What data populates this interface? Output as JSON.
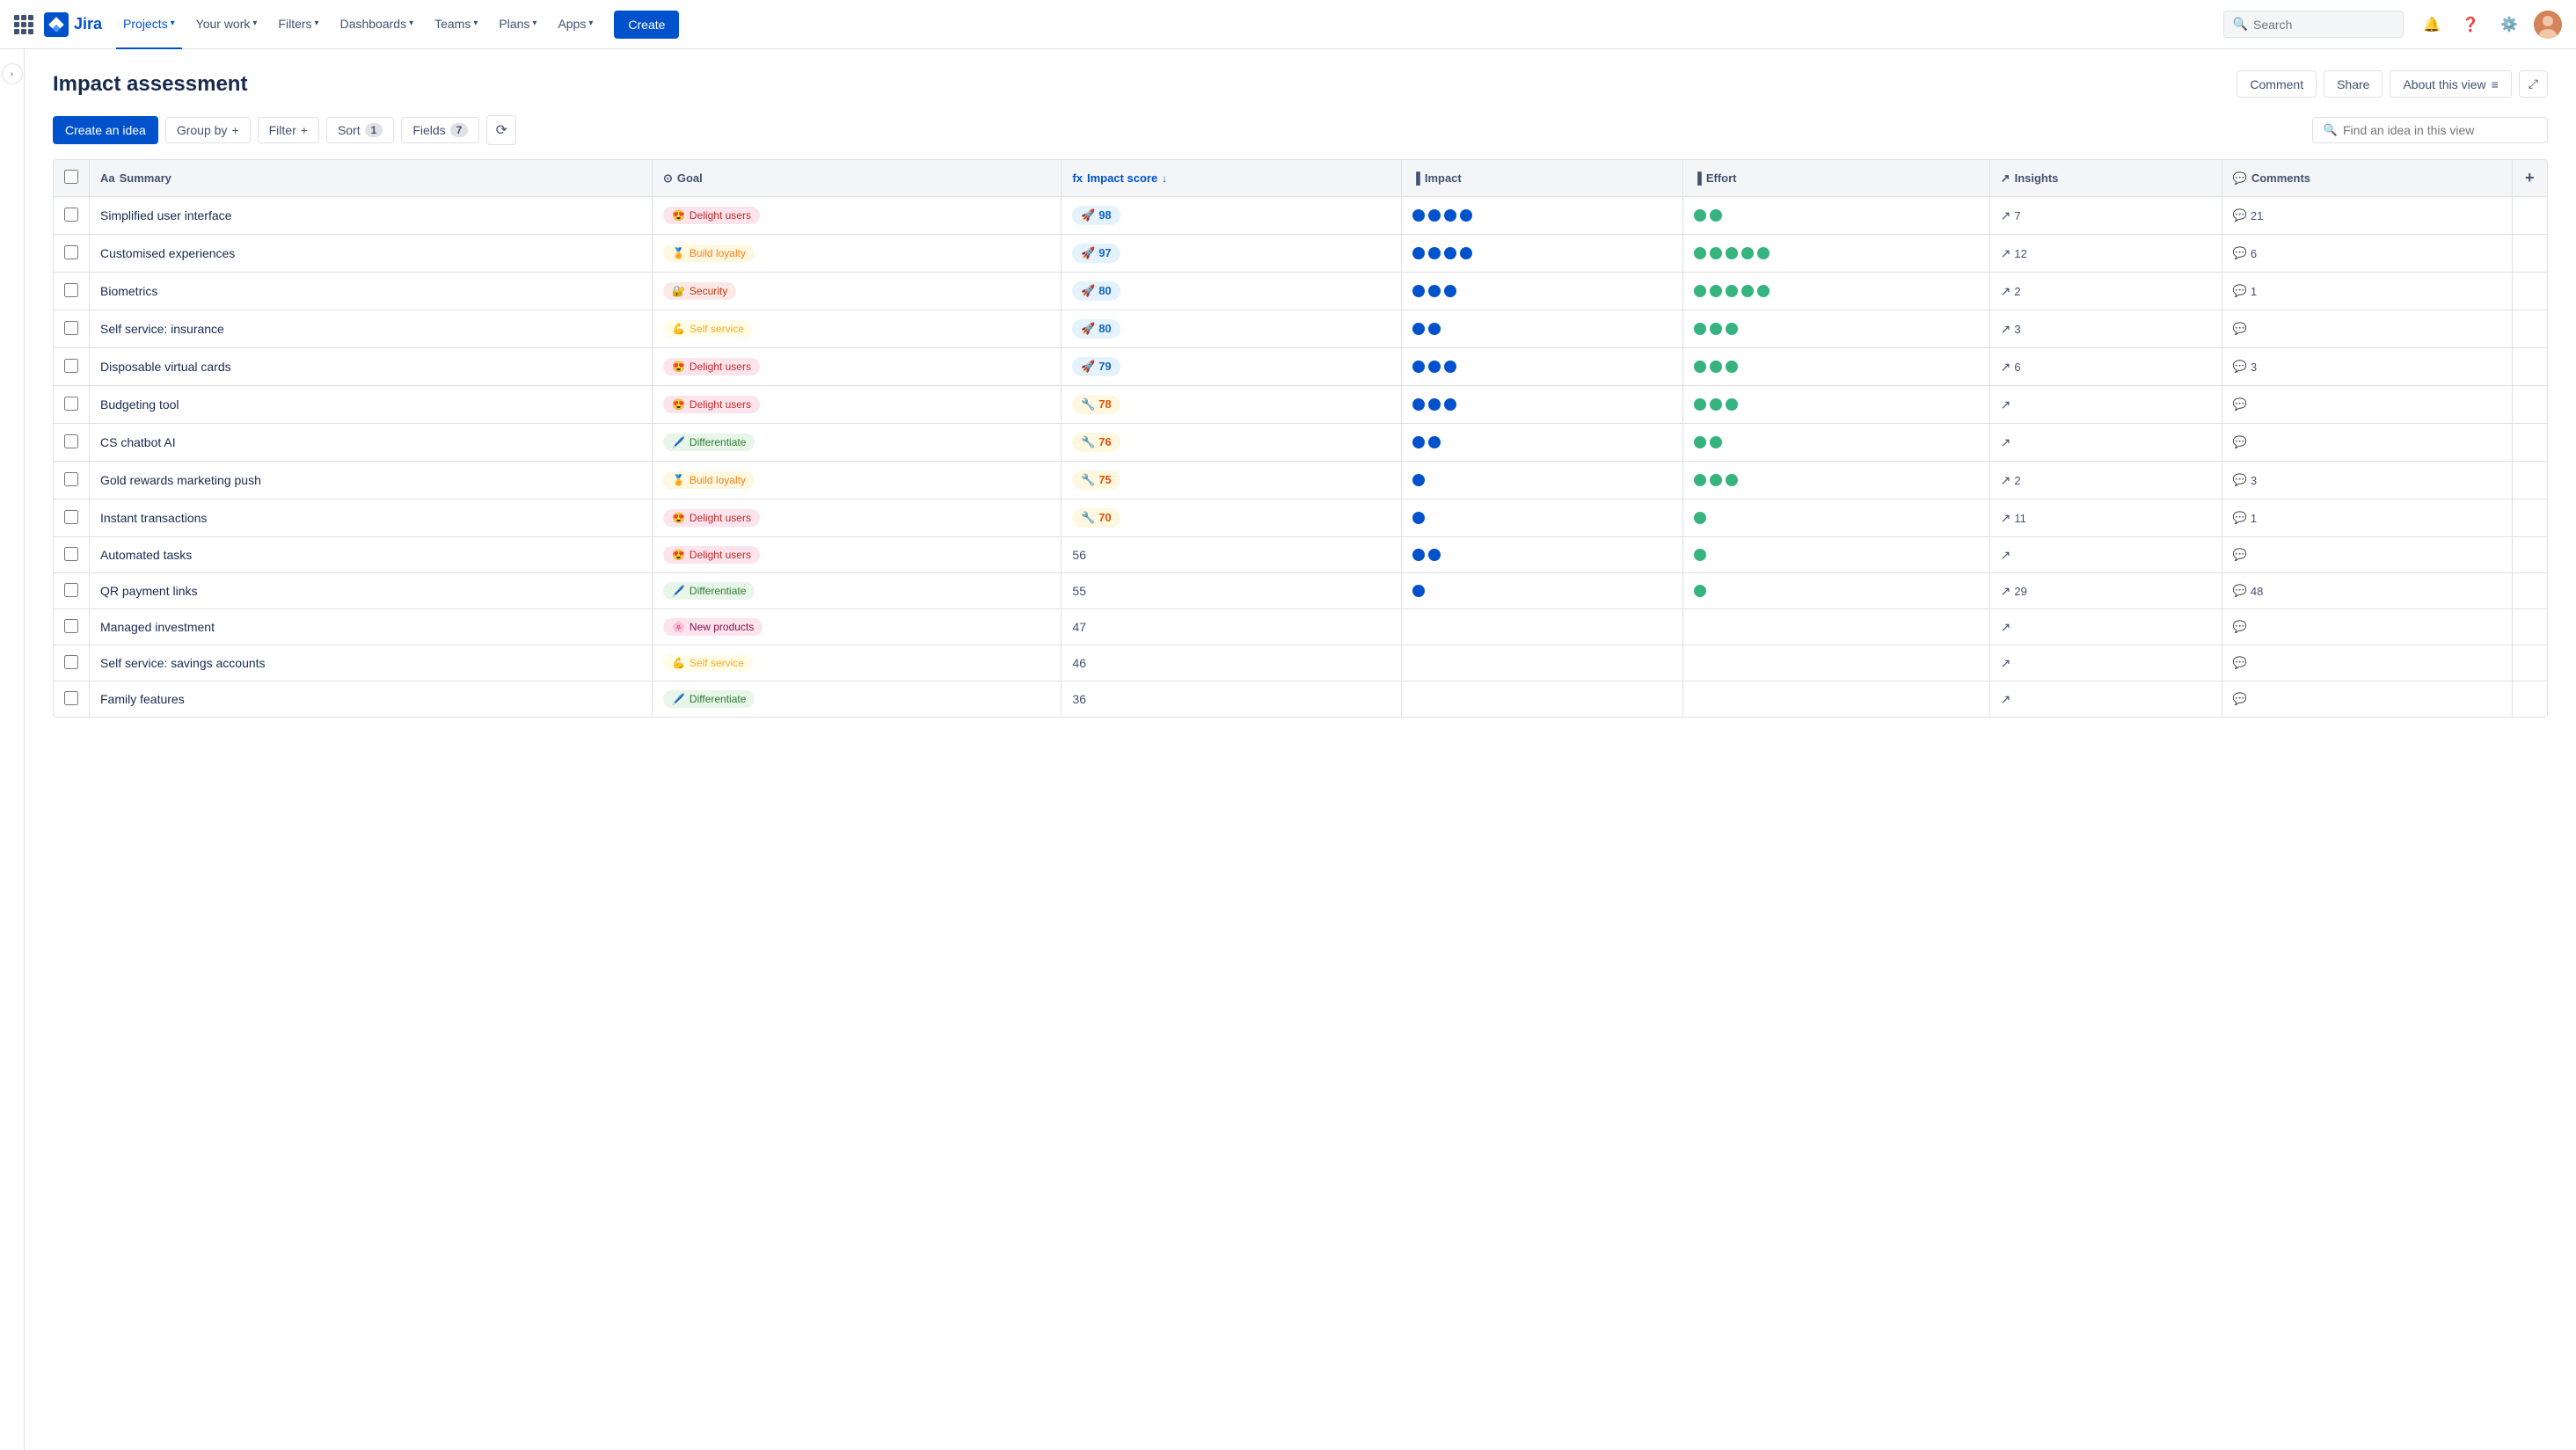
{
  "app": {
    "logo_text": "Jira"
  },
  "nav": {
    "items": [
      {
        "id": "your-work",
        "label": "Your work",
        "active": false
      },
      {
        "id": "projects",
        "label": "Projects",
        "active": true
      },
      {
        "id": "filters",
        "label": "Filters",
        "active": false
      },
      {
        "id": "dashboards",
        "label": "Dashboards",
        "active": false
      },
      {
        "id": "teams",
        "label": "Teams",
        "active": false
      },
      {
        "id": "plans",
        "label": "Plans",
        "active": false
      },
      {
        "id": "apps",
        "label": "Apps",
        "active": false
      }
    ],
    "create_label": "Create",
    "search_placeholder": "Search"
  },
  "page": {
    "title": "Impact assessment",
    "comment_btn": "Comment",
    "share_btn": "Share",
    "about_btn": "About this view"
  },
  "toolbar": {
    "create_idea": "Create an idea",
    "group_by": "Group by",
    "group_by_plus": "+",
    "filter": "Filter",
    "filter_plus": "+",
    "sort": "Sort",
    "sort_count": "1",
    "fields": "Fields",
    "fields_count": "7",
    "search_placeholder": "Find an idea in this view"
  },
  "table": {
    "columns": [
      {
        "id": "summary",
        "label": "Summary",
        "icon": "text-icon"
      },
      {
        "id": "goal",
        "label": "Goal",
        "icon": "goal-icon"
      },
      {
        "id": "impact_score",
        "label": "Impact score",
        "icon": "fx-icon",
        "sort": "desc",
        "highlight": true
      },
      {
        "id": "impact",
        "label": "Impact",
        "icon": "bar-icon"
      },
      {
        "id": "effort",
        "label": "Effort",
        "icon": "bar-icon"
      },
      {
        "id": "insights",
        "label": "Insights",
        "icon": "insights-icon"
      },
      {
        "id": "comments",
        "label": "Comments",
        "icon": "comments-icon"
      }
    ],
    "rows": [
      {
        "summary": "Simplified user interface",
        "goal_emoji": "😍",
        "goal_label": "Delight users",
        "goal_class": "goal-delight",
        "score": 98,
        "score_emoji": "🚀",
        "score_class": "score-high",
        "impact_dots": [
          "blue",
          "blue",
          "blue",
          "blue"
        ],
        "effort_dots": [
          "green",
          "green"
        ],
        "insights": 7,
        "comments": 21
      },
      {
        "summary": "Customised experiences",
        "goal_emoji": "🏅",
        "goal_label": "Build loyalty",
        "goal_class": "goal-loyalty",
        "score": 97,
        "score_emoji": "🚀",
        "score_class": "score-high",
        "impact_dots": [
          "blue",
          "blue",
          "blue",
          "blue"
        ],
        "effort_dots": [
          "green",
          "green",
          "green",
          "green",
          "green"
        ],
        "insights": 12,
        "comments": 6
      },
      {
        "summary": "Biometrics",
        "goal_emoji": "🔐",
        "goal_label": "Security",
        "goal_class": "goal-security",
        "score": 80,
        "score_emoji": "🚀",
        "score_class": "score-high",
        "impact_dots": [
          "blue",
          "blue",
          "blue"
        ],
        "effort_dots": [
          "green",
          "green",
          "green",
          "green",
          "green"
        ],
        "insights": 2,
        "comments": 1
      },
      {
        "summary": "Self service: insurance",
        "goal_emoji": "💪",
        "goal_label": "Self service",
        "goal_class": "goal-service",
        "score": 80,
        "score_emoji": "🚀",
        "score_class": "score-high",
        "impact_dots": [
          "blue",
          "blue"
        ],
        "effort_dots": [
          "green",
          "green",
          "green"
        ],
        "insights": 3,
        "comments": 0
      },
      {
        "summary": "Disposable virtual cards",
        "goal_emoji": "😍",
        "goal_label": "Delight users",
        "goal_class": "goal-delight",
        "score": 79,
        "score_emoji": "🚀",
        "score_class": "score-high",
        "impact_dots": [
          "blue",
          "blue",
          "blue"
        ],
        "effort_dots": [
          "green",
          "green",
          "green"
        ],
        "insights": 6,
        "comments": 3
      },
      {
        "summary": "Budgeting tool",
        "goal_emoji": "😍",
        "goal_label": "Delight users",
        "goal_class": "goal-delight",
        "score": 78,
        "score_emoji": "🔧",
        "score_class": "score-med",
        "impact_dots": [
          "blue",
          "blue",
          "blue"
        ],
        "effort_dots": [
          "green",
          "green",
          "green"
        ],
        "insights": 0,
        "comments": 0
      },
      {
        "summary": "CS chatbot AI",
        "goal_emoji": "🖊️",
        "goal_label": "Differentiate",
        "goal_class": "goal-differentiate",
        "score": 76,
        "score_emoji": "🔧",
        "score_class": "score-med",
        "impact_dots": [
          "blue",
          "blue"
        ],
        "effort_dots": [
          "green",
          "green"
        ],
        "insights": 0,
        "comments": 0
      },
      {
        "summary": "Gold rewards marketing push",
        "goal_emoji": "🏅",
        "goal_label": "Build loyalty",
        "goal_class": "goal-loyalty",
        "score": 75,
        "score_emoji": "🔧",
        "score_class": "score-med",
        "impact_dots": [
          "blue"
        ],
        "effort_dots": [
          "green",
          "green",
          "green"
        ],
        "insights": 2,
        "comments": 3
      },
      {
        "summary": "Instant transactions",
        "goal_emoji": "😍",
        "goal_label": "Delight users",
        "goal_class": "goal-delight",
        "score": 70,
        "score_emoji": "🔧",
        "score_class": "score-med",
        "impact_dots": [
          "blue"
        ],
        "effort_dots": [
          "green"
        ],
        "insights": 11,
        "comments": 1
      },
      {
        "summary": "Automated tasks",
        "goal_emoji": "😍",
        "goal_label": "Delight users",
        "goal_class": "goal-delight",
        "score": 56,
        "score_emoji": "",
        "score_class": "score-plain",
        "impact_dots": [
          "blue",
          "blue"
        ],
        "effort_dots": [
          "green"
        ],
        "insights": 0,
        "comments": 0
      },
      {
        "summary": "QR payment links",
        "goal_emoji": "🖊️",
        "goal_label": "Differentiate",
        "goal_class": "goal-differentiate",
        "score": 55,
        "score_emoji": "",
        "score_class": "score-plain",
        "impact_dots": [
          "blue"
        ],
        "effort_dots": [
          "green"
        ],
        "insights": 29,
        "comments": 48
      },
      {
        "summary": "Managed investment",
        "goal_emoji": "🌸",
        "goal_label": "New products",
        "goal_class": "goal-products",
        "score": 47,
        "score_emoji": "",
        "score_class": "score-plain",
        "impact_dots": [],
        "effort_dots": [],
        "insights": 0,
        "comments": 0
      },
      {
        "summary": "Self service: savings accounts",
        "goal_emoji": "💪",
        "goal_label": "Self service",
        "goal_class": "goal-service",
        "score": 46,
        "score_emoji": "",
        "score_class": "score-plain",
        "impact_dots": [],
        "effort_dots": [],
        "insights": 0,
        "comments": 0
      },
      {
        "summary": "Family features",
        "goal_emoji": "🖊️",
        "goal_label": "Differentiate",
        "goal_class": "goal-differentiate",
        "score": 36,
        "score_emoji": "",
        "score_class": "score-plain",
        "impact_dots": [],
        "effort_dots": [],
        "insights": 0,
        "comments": 0
      }
    ]
  }
}
